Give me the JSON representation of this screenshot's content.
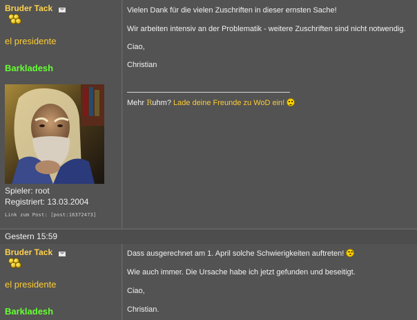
{
  "posts": [
    {
      "author": "Bruder Tack",
      "rank": "el presidente",
      "guild": "Barkladesh",
      "player_label": "Spieler: root",
      "registered_label": "Registriert: 13.03.2004",
      "permalink": "Link zum Post: [post:16372473]",
      "lines": [
        "Vielen Dank für die vielen Zuschriften in dieser ernsten Sache!",
        "Wir arbeiten intensiv an der Problematik - weitere Zuschriften sind nicht notwendig.",
        "Ciao,",
        "Christian"
      ],
      "signature": {
        "prefix": "Mehr ",
        "r": "R",
        "suffix": "uhm? ",
        "link": "Lade deine Freunde zu WoD ein!"
      }
    },
    {
      "author": "Bruder Tack",
      "rank": "el presidente",
      "guild": "Barkladesh",
      "lines": [
        "Dass ausgerechnet am 1. April solche Schwierigkeiten auftreten!",
        "Wie auch immer. Die Ursache habe ich jetzt gefunden und beseitigt.",
        "Ciao,",
        "Christian."
      ]
    }
  ],
  "date_row": "Gestern 15:59",
  "icons": {
    "mail": "mail-icon",
    "rank_badge": "coins-icon",
    "smiley": "smiley-icon",
    "wink": "wink-icon"
  },
  "colors": {
    "author": "#ffd24d",
    "guild": "#66ff33",
    "link": "#ffcc33"
  }
}
